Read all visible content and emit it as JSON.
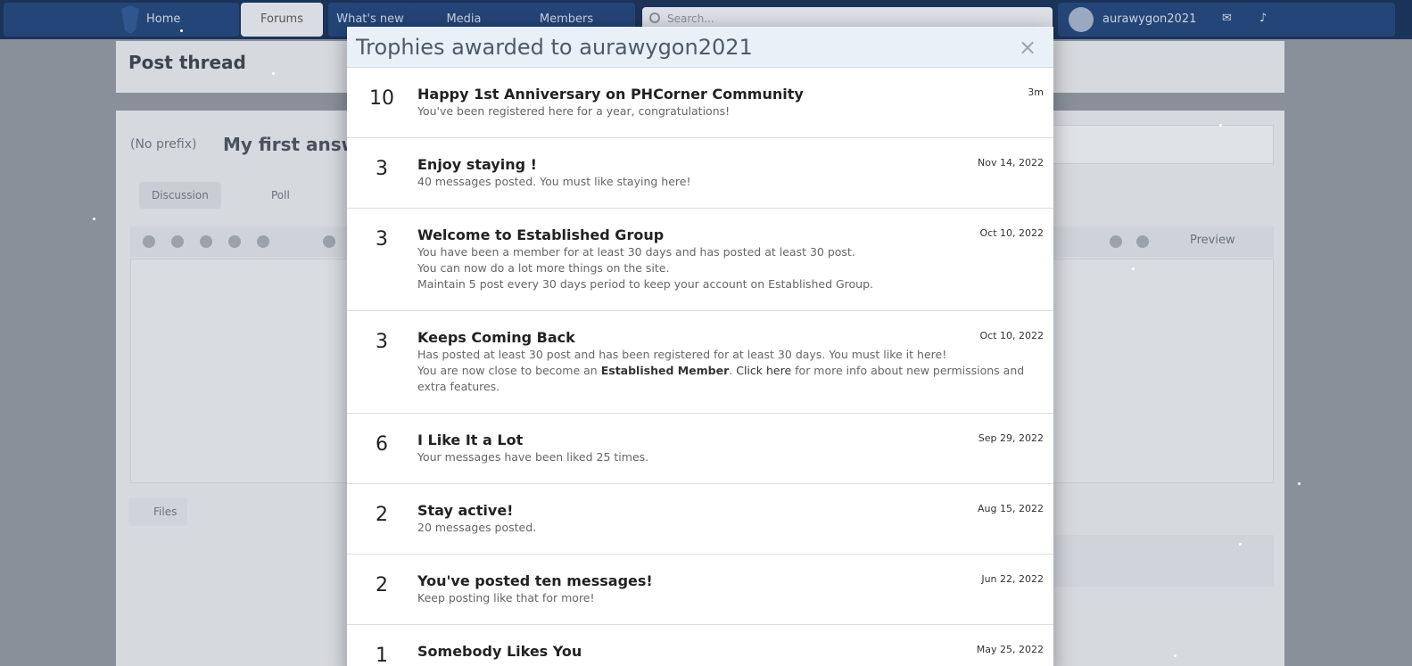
{
  "nav": {
    "home": "Home",
    "forums": "Forums",
    "whats_new": "What's new",
    "media": "Media",
    "members": "Members",
    "search_placeholder": "Search...",
    "username": "aurawygon2021"
  },
  "page": {
    "title": "Post thread",
    "crumb": "(No prefix)",
    "thread_title": "My first answer",
    "tab_discussion": "Discussion",
    "tab_poll": "Poll",
    "preview": "Preview",
    "attach": "Files"
  },
  "modal": {
    "title": "Trophies awarded to aurawygon2021",
    "close": "×",
    "trophies": [
      {
        "points": "10",
        "title": "Happy 1st Anniversary on PHCorner Community",
        "date": "3m",
        "lines": [
          "You've been registered here for a year, congratulations!"
        ]
      },
      {
        "points": "3",
        "title": "Enjoy staying !",
        "date": "Nov 14, 2022",
        "lines": [
          "40 messages posted. You must like staying here!"
        ]
      },
      {
        "points": "3",
        "title": "Welcome to Established Group",
        "date": "Oct 10, 2022",
        "lines": [
          "You have been a member for at least 30 days and has posted at least 30 post.",
          "You can now do a lot more things on the site.",
          "Maintain 5 post every 30 days period to keep your account on Established Group."
        ]
      },
      {
        "points": "3",
        "title": "Keeps Coming Back",
        "date": "Oct 10, 2022",
        "line1": "Has posted at least 30 post and has been registered for at least 30 days. You must like it here!",
        "line2_a": "You are now close to become an ",
        "line2_b": "Established Member",
        "line2_c": ". ",
        "line2_d": "Click here",
        "line2_e": " for more info about new permissions and extra features."
      },
      {
        "points": "6",
        "title": "I Like It a Lot",
        "date": "Sep 29, 2022",
        "lines": [
          "Your messages have been liked 25 times."
        ]
      },
      {
        "points": "2",
        "title": "Stay active!",
        "date": "Aug 15, 2022",
        "lines": [
          "20 messages posted."
        ]
      },
      {
        "points": "2",
        "title": "You've posted ten messages!",
        "date": "Jun 22, 2022",
        "lines": [
          "Keep posting like that for more!"
        ]
      },
      {
        "points": "1",
        "title": "Somebody Likes You",
        "date": "May 25, 2022",
        "lines": []
      }
    ]
  }
}
